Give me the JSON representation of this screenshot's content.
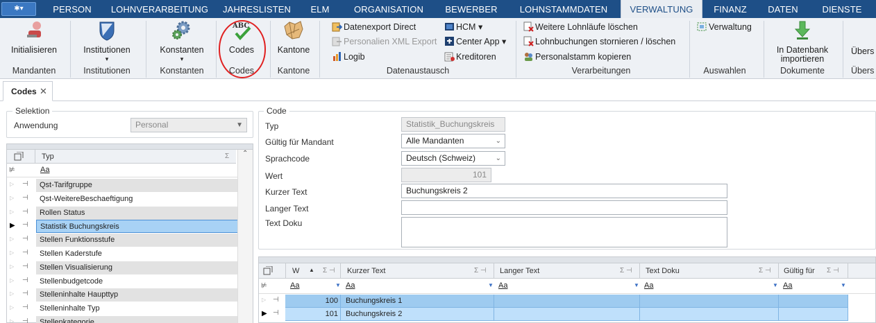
{
  "menubar": {
    "logo": "✱▾",
    "tabs": [
      "PERSON",
      "LOHNVERARBEITUNG",
      "JAHRESLISTEN",
      "ELM",
      "ORGANISATION",
      "BEWERBER",
      "LOHNSTAMMDATEN",
      "VERWALTUNG",
      "FINANZ",
      "DATEN",
      "DIENSTE"
    ],
    "active_tab": "VERWALTUNG"
  },
  "ribbon": {
    "groups": {
      "mandanten": {
        "button": "Initialisieren",
        "label": "Mandanten"
      },
      "institutionen": {
        "button": "Institutionen",
        "label": "Institutionen",
        "arrow": "▾"
      },
      "konstanten": {
        "button": "Konstanten",
        "label": "Konstanten",
        "arrow": "▾"
      },
      "codes": {
        "button": "Codes",
        "label": "Codes",
        "icon_text": "ABC"
      },
      "kantone": {
        "button": "Kantone",
        "label": "Kantone"
      },
      "datenaustausch": {
        "label": "Datenaustausch",
        "items": [
          "Datenexport Direct",
          "Personalien XML Export",
          "Logib"
        ],
        "items2": [
          "HCM ▾",
          "Center App ▾",
          "Kreditoren"
        ]
      },
      "verarbeitungen": {
        "label": "Verarbeitungen",
        "items": [
          "Weitere Lohnläufe löschen",
          "Lohnbuchungen stornieren / löschen",
          "Personalstamm kopieren"
        ]
      },
      "auswahlen": {
        "label": "Auswahlen",
        "item": "Verwaltung"
      },
      "dokumente": {
        "label": "Dokumente",
        "button_line1": "In Datenbank",
        "button_line2": "importieren"
      },
      "cut": {
        "label": "Übers",
        "button": "Übers"
      }
    },
    "highlight_color": "#e02020"
  },
  "doctab": {
    "label": "Codes",
    "close": "✕"
  },
  "selektion": {
    "legend": "Selektion",
    "anwendung_label": "Anwendung",
    "anwendung_value": "Personal"
  },
  "typgrid": {
    "header": "Typ",
    "sigma": "Σ",
    "filter": "Aa",
    "selected_index": 3,
    "rows": [
      "Qst-Tarifgruppe",
      "Qst-WeitereBeschaeftigung",
      "Rollen Status",
      "Statistik Buchungskreis",
      "Stellen Funktionsstufe",
      "Stellen Kaderstufe",
      "Stellen Visualisierung",
      "Stellenbudgetcode",
      "Stelleninhalte Haupttyp",
      "Stelleninhalte Typ",
      "Stellenkategorie"
    ]
  },
  "code": {
    "legend": "Code",
    "typ_label": "Typ",
    "typ_value": "Statistik_Buchungskreis",
    "mandant_label": "Gültig für Mandant",
    "mandant_value": "Alle Mandanten",
    "sprach_label": "Sprachcode",
    "sprach_value": "Deutsch (Schweiz)",
    "wert_label": "Wert",
    "wert_value": "101",
    "kurz_label": "Kurzer Text",
    "kurz_value": "Buchungskreis 2",
    "lang_label": "Langer Text",
    "lang_value": "",
    "doku_label": "Text Doku",
    "doku_value": ""
  },
  "codegrid": {
    "columns": [
      "W",
      "Kurzer Text",
      "Langer Text",
      "Text Doku",
      "Gültig für"
    ],
    "sort_mark": "▲",
    "sigma": "Σ ⊣",
    "filter": "Aa",
    "rows": [
      {
        "wert": "100",
        "kurz": "Buchungskreis 1"
      },
      {
        "wert": "101",
        "kurz": "Buchungskreis 2"
      }
    ]
  }
}
